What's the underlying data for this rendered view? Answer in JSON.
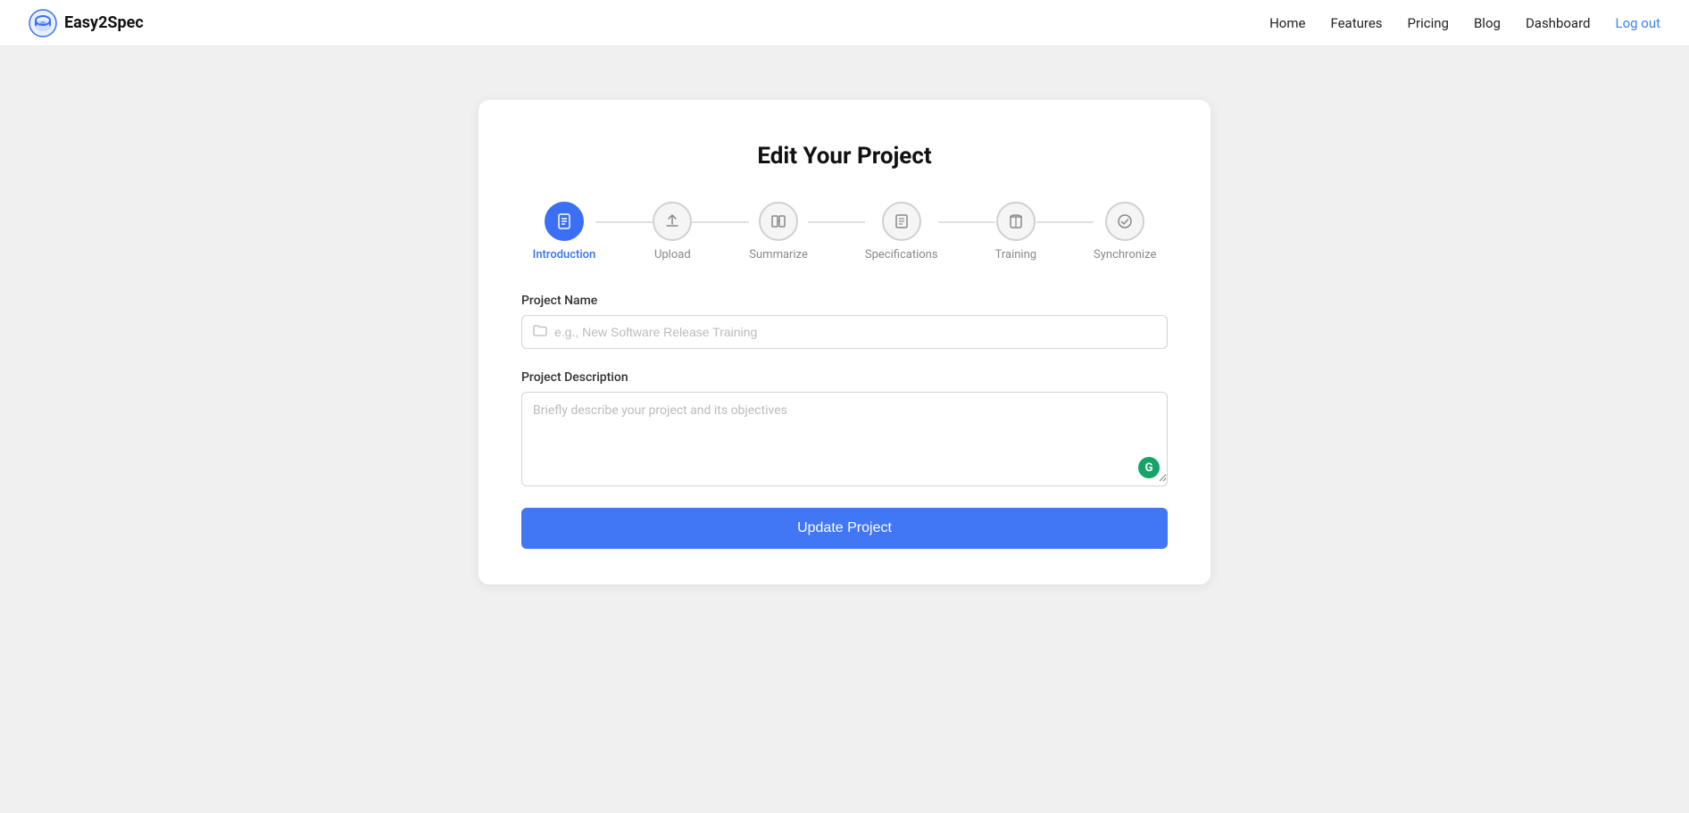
{
  "nav": {
    "brand": "Easy2Spec",
    "links": [
      {
        "label": "Home",
        "id": "home"
      },
      {
        "label": "Features",
        "id": "features"
      },
      {
        "label": "Pricing",
        "id": "pricing"
      },
      {
        "label": "Blog",
        "id": "blog"
      },
      {
        "label": "Dashboard",
        "id": "dashboard"
      }
    ],
    "logout_label": "Log out"
  },
  "page": {
    "title": "Edit Your Project"
  },
  "stepper": {
    "steps": [
      {
        "label": "Introduction",
        "id": "introduction",
        "active": true,
        "icon": "📄"
      },
      {
        "label": "Upload",
        "id": "upload",
        "active": false,
        "icon": "⬆"
      },
      {
        "label": "Summarize",
        "id": "summarize",
        "active": false,
        "icon": "⇄"
      },
      {
        "label": "Specifications",
        "id": "specifications",
        "active": false,
        "icon": "📋"
      },
      {
        "label": "Training",
        "id": "training",
        "active": false,
        "icon": "📖"
      },
      {
        "label": "Synchronize",
        "id": "synchronize",
        "active": false,
        "icon": "✓"
      }
    ]
  },
  "form": {
    "project_name_label": "Project Name",
    "project_name_placeholder": "e.g., New Software Release Training",
    "project_name_value": "",
    "project_description_label": "Project Description",
    "project_description_placeholder": "Briefly describe your project and its objectives",
    "project_description_value": ""
  },
  "buttons": {
    "update_project": "Update Project"
  }
}
